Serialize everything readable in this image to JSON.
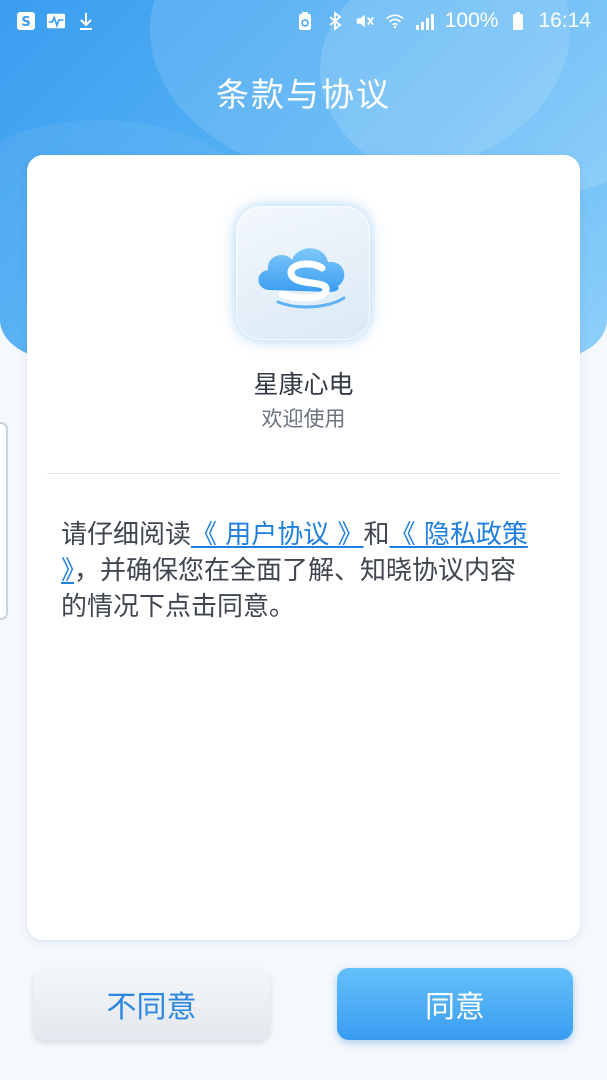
{
  "status_bar": {
    "battery_percent": "100%",
    "time": "16:14",
    "left_icons": [
      "s-app-icon",
      "pulse-icon",
      "download-icon"
    ],
    "right_icons": [
      "battery-saver-icon",
      "bluetooth-icon",
      "mute-icon",
      "wifi-icon",
      "signal-icon",
      "battery-icon"
    ]
  },
  "page": {
    "title": "条款与协议"
  },
  "card": {
    "app_name": "星康心电",
    "app_subtitle": "欢迎使用",
    "agreement": {
      "prefix": "请仔细阅读",
      "user_agreement_link": "《 用户协议 》",
      "conjunction": "和",
      "privacy_policy_link": "《 隐私政策 》",
      "suffix": "，并确保您在全面了解、知晓协议内容的情况下点击同意。"
    }
  },
  "buttons": {
    "disagree_label": "不同意",
    "agree_label": "同意"
  },
  "colors": {
    "accent": "#3a9cf0",
    "link": "#1f7fe0",
    "header_start": "#3a9df0",
    "header_end": "#8fd0fa"
  }
}
